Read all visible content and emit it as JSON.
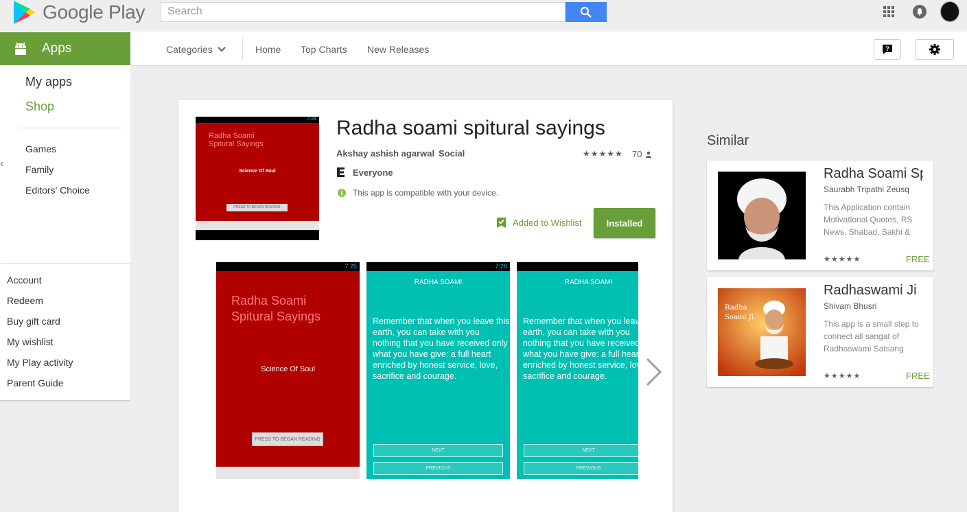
{
  "header": {
    "logo_text": "Google Play",
    "search_placeholder": "Search"
  },
  "nav": {
    "apps_label": "Apps",
    "categories": "Categories",
    "home": "Home",
    "top_charts": "Top Charts",
    "new_releases": "New Releases"
  },
  "sidebar": {
    "my_apps": "My apps",
    "shop": "Shop",
    "games": "Games",
    "family": "Family",
    "editors_choice": "Editors' Choice",
    "account": "Account",
    "redeem": "Redeem",
    "buy_gift_card": "Buy gift card",
    "my_wishlist": "My wishlist",
    "my_play_activity": "My Play activity",
    "parent_guide": "Parent Guide"
  },
  "app": {
    "title": "Radha soami spitural sayings",
    "developer": "Akshay ashish agarwal",
    "category": "Social",
    "rating_count": "70",
    "content_rating": "Everyone",
    "compat": "This app is compatible with your device.",
    "wishlist": "Added to Wishlist",
    "install": "Installed",
    "icon": {
      "time": "7:29",
      "line1": "Radha Soami",
      "line2": "Spitural Sayings",
      "sub": "Science Of Soul",
      "button": "PRESS TO BEGAN READING"
    }
  },
  "screenshots": {
    "shot1": {
      "time": "7:25",
      "line1": "Radha Soami",
      "line2": "Spitural Sayings",
      "sub": "Science Of Soul",
      "button": "PRESS TO BEGAN READING"
    },
    "shot2": {
      "time": "7:28",
      "heading": "RADHA SOAMI",
      "quote": "Remember that when you leave this earth, you can take with you nothing that you have received only what you have give: a full heart enriched by honest service, love, sacrifice and courage.",
      "next": "NEXT",
      "previous": "PREVIOUS"
    },
    "shot3": {
      "heading": "RADHA SOAMI",
      "quote": "Remember that when you leave this earth, you can take with you nothing that you have received only what you have give: a full heart enriched by honest service, love, sacrifice and courage.",
      "next": "NEXT",
      "previous": "PREVIOUS"
    }
  },
  "similar": {
    "heading": "Similar",
    "items": [
      {
        "title": "Radha Soami Sp",
        "developer": "Saurabh Tripathi Zeusq",
        "description": "This Application contain Motivational Quotes, RS News, Shabad, Sakhi &",
        "price": "FREE"
      },
      {
        "title": "Radhaswami Ji",
        "developer": "Shivam Bhusri",
        "description": "This app is a small step to connect all sangat of Radhaswami Satsang",
        "price": "FREE",
        "image_text_1": "Radha",
        "image_text_2": "Soami Ji"
      }
    ]
  },
  "colors": {
    "accent_green": "#689f38",
    "search_blue": "#4285f4",
    "app_red": "#b00000",
    "teal": "#00bfb3"
  }
}
